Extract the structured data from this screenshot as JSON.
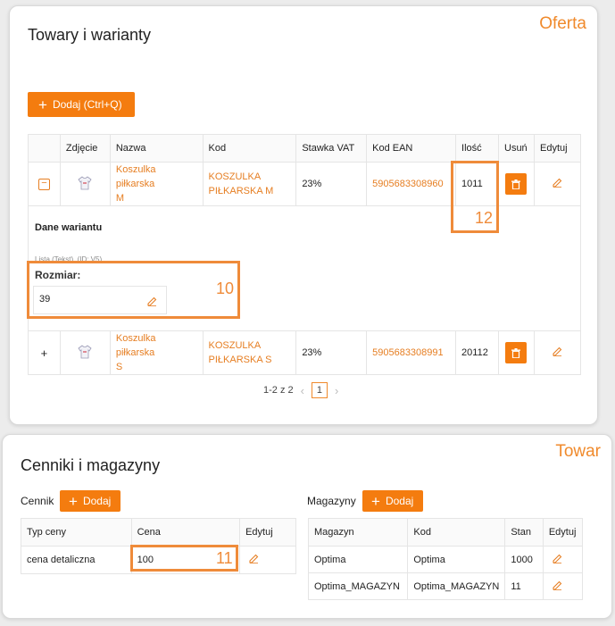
{
  "offer": {
    "tag": "Oferta",
    "title": "Towary i warianty",
    "add_label": "Dodaj (Ctrl+Q)",
    "columns": [
      "",
      "Zdjęcie",
      "Nazwa",
      "Kod",
      "Stawka VAT",
      "Kod EAN",
      "Ilość",
      "Usuń",
      "Edytuj"
    ],
    "rows": [
      {
        "toggle": "−",
        "name_l1": "Koszulka piłkarska",
        "name_l2": "M",
        "code_l1": "KOSZULKA",
        "code_l2": "PIŁKARSKA M",
        "vat": "23%",
        "ean": "5905683308960",
        "qty": "1011"
      },
      {
        "toggle": "+",
        "name_l1": "Koszulka piłkarska",
        "name_l2": "S",
        "code_l1": "KOSZULKA",
        "code_l2": "PIŁKARSKA S",
        "vat": "23%",
        "ean": "5905683308991",
        "qty": "20112"
      }
    ],
    "variant": {
      "title": "Dane wariantu",
      "meta": "Lista (Tekst), (ID: V5)",
      "field_label": "Rozmiar:",
      "field_value": "39"
    },
    "pager": {
      "summary": "1-2 z 2",
      "prev": "‹",
      "page": "1",
      "next": "›"
    },
    "callouts": {
      "qty": "12",
      "variant": "10"
    }
  },
  "goods": {
    "tag": "Towar",
    "title": "Cenniki i magazyny",
    "pricelist": {
      "label": "Cennik",
      "add_label": "Dodaj",
      "columns": [
        "Typ ceny",
        "Cena",
        "Edytuj"
      ],
      "rows": [
        {
          "type": "cena detaliczna",
          "price": "100"
        }
      ],
      "callout": "11"
    },
    "warehouse": {
      "label": "Magazyny",
      "add_label": "Dodaj",
      "columns": [
        "Magazyn",
        "Kod",
        "Stan",
        "Edytuj"
      ],
      "rows": [
        {
          "name": "Optima",
          "code": "Optima",
          "stock": "1000"
        },
        {
          "name": "Optima_MAGAZYN",
          "code": "Optima_MAGAZYN",
          "stock": "11"
        }
      ]
    }
  },
  "colors": {
    "accent": "#f47c0f",
    "highlight": "#ef8b3a",
    "link": "#e67e22"
  }
}
